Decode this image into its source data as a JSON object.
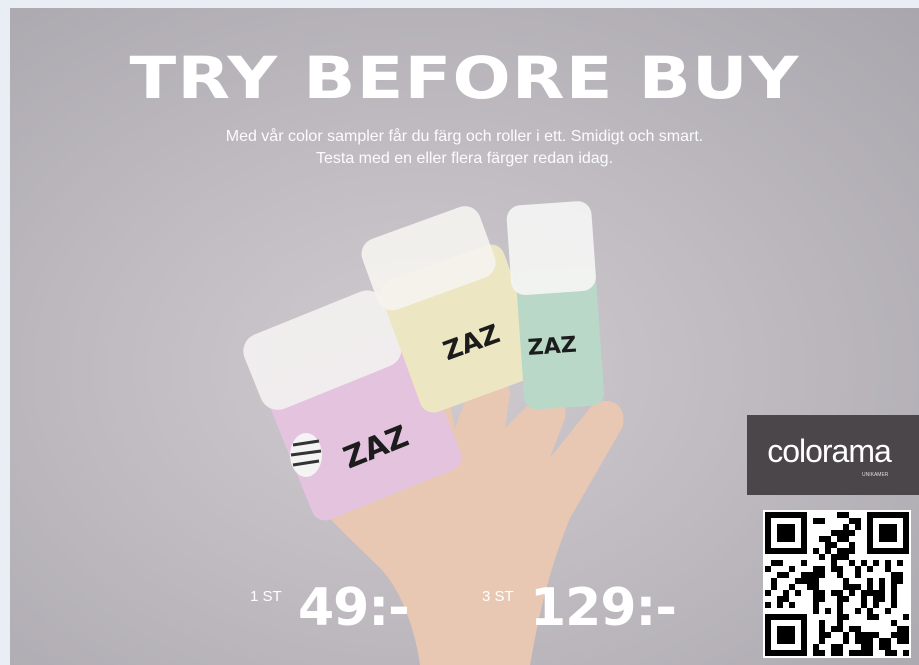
{
  "headline": "TRY BEFORE BUY",
  "subtitle_line1": "Med vår color sampler får du färg och roller i ett. Smidigt och smart.",
  "subtitle_line2": "Testa med en eller flera färger redan idag.",
  "prices": [
    {
      "qty": "1 ST",
      "price": "49:-"
    },
    {
      "qty": "3 ST",
      "price": "129:-"
    }
  ],
  "brand": {
    "name": "colorama",
    "tagline": "UNIKAMER"
  },
  "product_label": "ZAZ",
  "colors": {
    "background": "#bfbbc1",
    "pink": "#e3c3de",
    "cream": "#ece6c2",
    "mint": "#b9d8c8",
    "logo_bg": "#4a4649"
  }
}
